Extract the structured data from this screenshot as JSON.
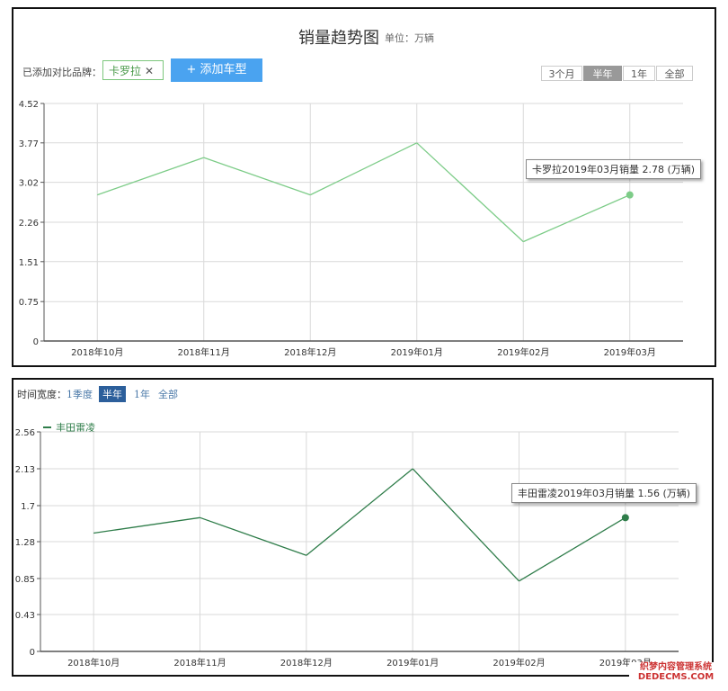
{
  "chart1": {
    "title": "销量趋势图",
    "unit": "单位：万辆",
    "added_label": "已添加对比品牌：",
    "brand_tag": "卡罗拉",
    "add_button": "+ 添加车型",
    "ranges": [
      "3个月",
      "半年",
      "1年",
      "全部"
    ],
    "active_range": "半年",
    "tooltip": "卡罗拉2019年03月销量 2.78 (万辆)",
    "color": "#7dcc88"
  },
  "chart2": {
    "timeline_label": "时间宽度：",
    "options": [
      "1季度",
      "半年",
      "1年",
      "全部"
    ],
    "active_option": "半年",
    "legend": "丰田雷凌",
    "tooltip": "丰田雷凌2019年03月销量 1.56 (万辆)",
    "color": "#2f7d4a"
  },
  "watermark": [
    "织梦内容管理系统",
    "DEDECMS.COM"
  ],
  "chart_data": [
    {
      "type": "line",
      "title": "销量趋势图",
      "ylabel": "单位：万辆",
      "categories": [
        "2018年10月",
        "2018年11月",
        "2018年12月",
        "2019年01月",
        "2019年02月",
        "2019年03月"
      ],
      "series": [
        {
          "name": "卡罗拉",
          "values": [
            2.78,
            3.49,
            2.78,
            3.77,
            1.89,
            2.78
          ]
        }
      ],
      "yticks": [
        "0",
        "0.75",
        "1.51",
        "2.26",
        "3.02",
        "3.77",
        "4.52"
      ],
      "ylim": [
        0,
        4.52
      ],
      "grid": true
    },
    {
      "type": "line",
      "categories": [
        "2018年10月",
        "2018年11月",
        "2018年12月",
        "2019年01月",
        "2019年02月",
        "2019年03月"
      ],
      "series": [
        {
          "name": "丰田雷凌",
          "values": [
            1.38,
            1.56,
            1.12,
            2.13,
            0.82,
            1.56
          ]
        }
      ],
      "yticks": [
        "0",
        "0.43",
        "0.85",
        "1.28",
        "1.7",
        "2.13",
        "2.56"
      ],
      "ylim": [
        0,
        2.56
      ],
      "grid": true
    }
  ]
}
